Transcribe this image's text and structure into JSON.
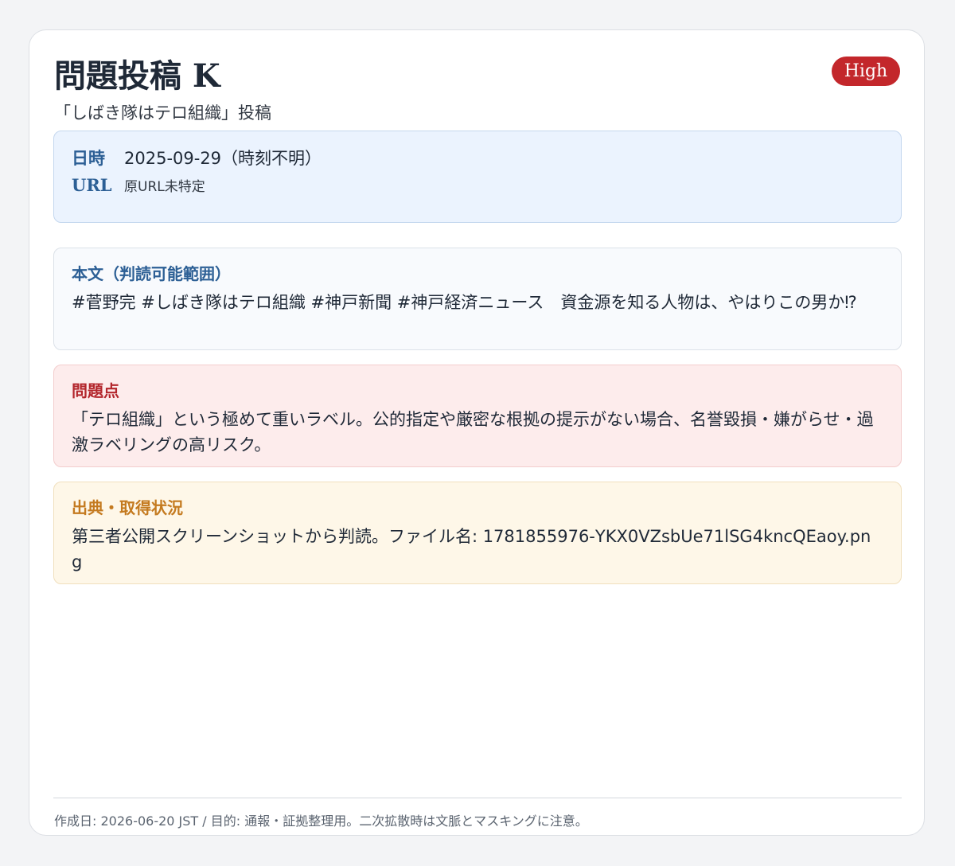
{
  "header": {
    "title": "問題投稿 K",
    "subtitle": "「しばき隊はテロ組織」投稿",
    "badge": "High"
  },
  "meta": {
    "date_label": "日時",
    "date_value": "2025-09-29（時刻不明）",
    "url_label": "URL",
    "url_value": "原URL未特定"
  },
  "sections": {
    "body": {
      "title": "本文（判読可能範囲）",
      "text": "#菅野完 #しばき隊はテロ組織 #神戸新聞 #神戸経済ニュース　資金源を知る人物は、やはりこの男か⁉"
    },
    "problem": {
      "title": "問題点",
      "text": "「テロ組織」という極めて重いラベル。公的指定や厳密な根拠の提示がない場合、名誉毀損・嫌がらせ・過激ラベリングの高リスク。"
    },
    "source": {
      "title": "出典・取得状況",
      "text": "第三者公開スクリーンショットから判読。ファイル名: 1781855976-YKX0VZsbUe71lSG4kncQEaoy.png"
    }
  },
  "footer": {
    "text": "作成日: 2026-06-20 JST / 目的: 通報・証拠整理用。二次拡散時は文脈とマスキングに注意。"
  },
  "colors": {
    "badge": "#c3272b",
    "meta_bg": "#ebf3fe",
    "body_bg": "#f8fafd",
    "problem_bg": "#fdecec",
    "source_bg": "#fef7e8",
    "blue_heading": "#2c5f95",
    "red_heading": "#b3262c",
    "orange_heading": "#c47a1f"
  }
}
